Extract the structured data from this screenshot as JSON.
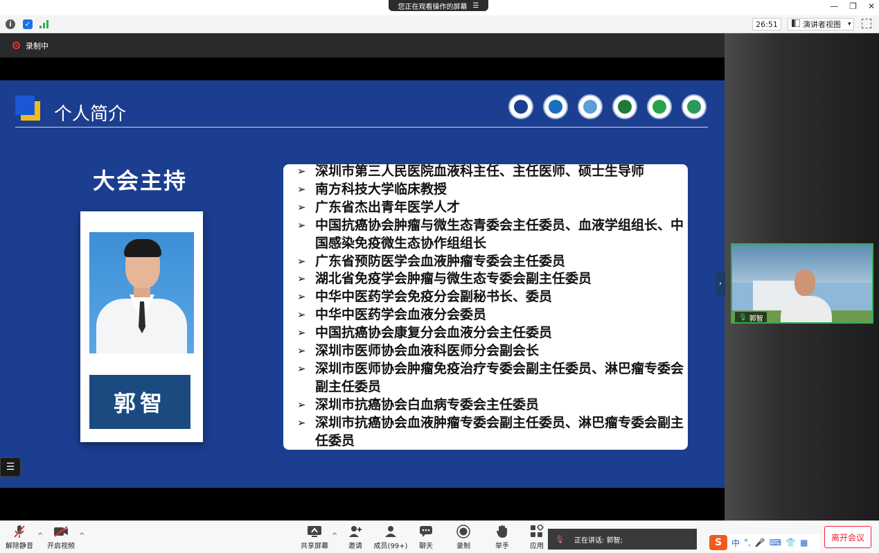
{
  "window": {
    "notice": "您正在观看操作的屏幕",
    "notice_menu": "☰",
    "controls": {
      "minimize": "—",
      "restore": "❐",
      "close": "✕"
    }
  },
  "infobar": {
    "timer": "26:51",
    "view_label": "演讲者视图",
    "view_caret": "▾"
  },
  "recording": {
    "label": "录制中"
  },
  "slide": {
    "title": "个人简介",
    "host_title": "大会主持",
    "host_name": "郭智",
    "bullet": "➢",
    "bio": [
      "深圳市第三人民医院血液科主任、主任医师、硕士生导师",
      "南方科技大学临床教授",
      "广东省杰出青年医学人才",
      "中国抗癌协会肿瘤与微生态青委会主任委员、血液学组组长、中国感染免疫微生态协作组组长",
      "广东省预防医学会血液肿瘤专委会主任委员",
      "湖北省免疫学会肿瘤与微生态专委会副主任委员",
      "中华中医药学会免疫分会副秘书长、委员",
      "中华中医药学会血液分会委员",
      "中国抗癌协会康复分会血液分会主任委员",
      "深圳市医师协会血液科医师分会副会长",
      "深圳市医师协会肿瘤免疫治疗专委会副主任委员、淋巴瘤专委会副主任委员",
      "深圳市抗癌协会白血病专委会主任委员",
      "深圳市抗癌协会血液肿瘤专委会副主任委员、淋巴瘤专委会副主任委员"
    ],
    "logo_colors": [
      "#1b3e90",
      "#1a6fc0",
      "#5aa0d8",
      "#1f7a3a",
      "#2aa24b",
      "#2b9a5a"
    ]
  },
  "video": {
    "participant": "郭智"
  },
  "toolbar": {
    "mute": "解除静音",
    "video": "开启视频",
    "share": "共享屏幕",
    "invite": "邀请",
    "members": "成员(99+)",
    "chat": "聊天",
    "record": "录制",
    "raise_hand": "举手",
    "apps": "应用",
    "speaking": "正在讲话: 郭智;",
    "leave": "离开会议"
  },
  "ime": {
    "logo": "S",
    "lang": "中",
    "punct": "°,"
  }
}
